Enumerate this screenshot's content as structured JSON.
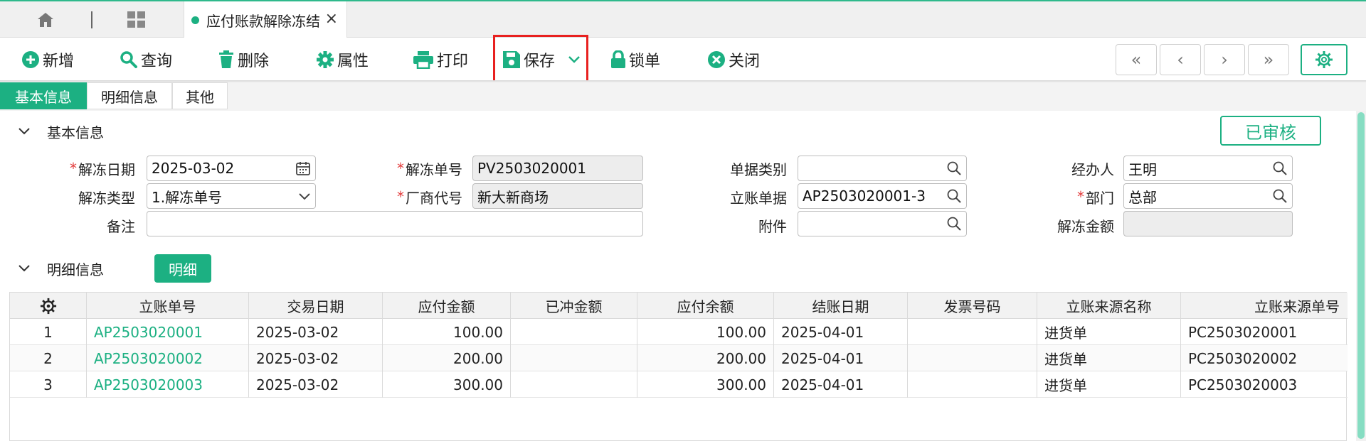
{
  "tabbar": {
    "doc_tab_title": "应付账款解除冻结",
    "close_glyph": "×"
  },
  "toolbar": {
    "add": "新增",
    "query": "查询",
    "delete": "删除",
    "properties": "属性",
    "print": "打印",
    "save": "保存",
    "lock": "锁单",
    "close": "关闭",
    "nav_first": "«",
    "nav_prev": "‹",
    "nav_next": "›",
    "nav_last": "»"
  },
  "section_tabs": [
    {
      "label": "基本信息"
    },
    {
      "label": "明细信息"
    },
    {
      "label": "其他"
    }
  ],
  "basic": {
    "header": "基本信息",
    "status": "已审核",
    "labels": {
      "unfreeze_date": "解冻日期",
      "unfreeze_no": "解冻单号",
      "doc_category": "单据类别",
      "handler": "经办人",
      "unfreeze_type": "解冻类型",
      "vendor_code": "厂商代号",
      "ledger_doc": "立账单据",
      "department": "部门",
      "remark": "备注",
      "attachment": "附件",
      "unfreeze_amount": "解冻金额"
    },
    "values": {
      "unfreeze_date": "2025-03-02",
      "unfreeze_no": "PV2503020001",
      "doc_category": "",
      "handler": "王明",
      "unfreeze_type": "1.解冻单号",
      "vendor_code": "新大新商场",
      "ledger_doc": "AP2503020001-3",
      "department": "总部",
      "remark": "",
      "attachment": "",
      "unfreeze_amount": ""
    },
    "required_mark": "*"
  },
  "detail": {
    "header": "明细信息",
    "detail_button": "明细",
    "columns": [
      "立账单号",
      "交易日期",
      "应付金额",
      "已冲金额",
      "应付余额",
      "结账日期",
      "发票号码",
      "立账来源名称",
      "立账来源单号"
    ],
    "rows": [
      {
        "idx": "1",
        "ledger_no": "AP2503020001",
        "trade_date": "2025-03-02",
        "payable": "100.00",
        "offset": "",
        "balance": "100.00",
        "close_date": "2025-04-01",
        "invoice": "",
        "src_name": "进货单",
        "src_no": "PC2503020001"
      },
      {
        "idx": "2",
        "ledger_no": "AP2503020002",
        "trade_date": "2025-03-02",
        "payable": "200.00",
        "offset": "",
        "balance": "200.00",
        "close_date": "2025-04-01",
        "invoice": "",
        "src_name": "进货单",
        "src_no": "PC2503020002"
      },
      {
        "idx": "3",
        "ledger_no": "AP2503020003",
        "trade_date": "2025-03-02",
        "payable": "300.00",
        "offset": "",
        "balance": "300.00",
        "close_date": "2025-04-01",
        "invoice": "",
        "src_name": "进货单",
        "src_no": "PC2503020003"
      }
    ]
  },
  "colors": {
    "accent": "#1cb082",
    "highlight": "#e8201f",
    "required": "#e23b3b"
  },
  "icons": [
    "home-icon",
    "grid-icon",
    "plus-circle-icon",
    "search-icon",
    "trash-icon",
    "gear-icon",
    "printer-icon",
    "save-icon",
    "chevron-down-icon",
    "lock-icon",
    "close-circle-icon",
    "calendar-icon",
    "magnifier-icon"
  ]
}
